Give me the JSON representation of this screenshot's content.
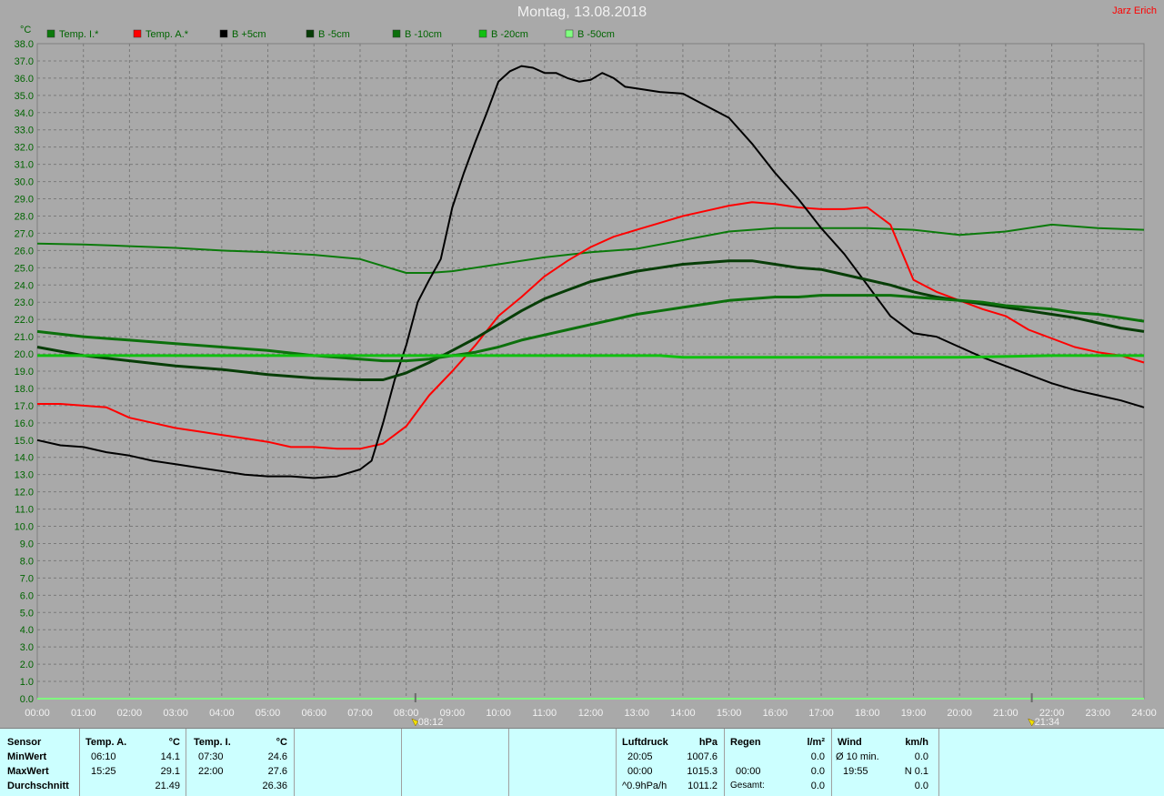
{
  "header": {
    "title": "Montag, 13.08.2018",
    "author": "Jarz Erich"
  },
  "colors": {
    "temp_i": "#0b7a0b",
    "temp_a": "#ff0000",
    "b5": "#000000",
    "bm5": "#073d07",
    "bm10": "#0c700c",
    "bm20": "#10c010",
    "bm50": "#80ff80",
    "axis_text": "#006400",
    "background": "#a9a9a9",
    "panel": "#ccffff"
  },
  "chart_data": {
    "type": "line",
    "ylabel": "°C",
    "ylim": [
      0,
      38
    ],
    "xlim": [
      0,
      24
    ],
    "yticks": [
      "0.0",
      "1.0",
      "2.0",
      "3.0",
      "4.0",
      "5.0",
      "6.0",
      "7.0",
      "8.0",
      "9.0",
      "10.0",
      "11.0",
      "12.0",
      "13.0",
      "14.0",
      "15.0",
      "16.0",
      "17.0",
      "18.0",
      "19.0",
      "20.0",
      "21.0",
      "22.0",
      "23.0",
      "24.0",
      "25.0",
      "26.0",
      "27.0",
      "28.0",
      "29.0",
      "30.0",
      "31.0",
      "32.0",
      "33.0",
      "34.0",
      "35.0",
      "36.0",
      "37.0",
      "38.0"
    ],
    "xticks": [
      "00:00",
      "01:00",
      "02:00",
      "03:00",
      "04:00",
      "05:00",
      "06:00",
      "07:00",
      "08:00",
      "09:00",
      "10:00",
      "11:00",
      "12:00",
      "13:00",
      "14:00",
      "15:00",
      "16:00",
      "17:00",
      "18:00",
      "19:00",
      "20:00",
      "21:00",
      "22:00",
      "23:00",
      "24:00"
    ],
    "grid": true,
    "legend_position": "top-left",
    "sunrise": "08:12",
    "sunset": "21:34",
    "series": [
      {
        "name": "Temp. I.*",
        "color": "#0b7a0b",
        "x": [
          0,
          1,
          2,
          3,
          4,
          5,
          6,
          7,
          7.5,
          8,
          8.5,
          9,
          10,
          11,
          12,
          13,
          14,
          15,
          16,
          17,
          18,
          19,
          20,
          21,
          22,
          23,
          24
        ],
        "y": [
          26.4,
          26.35,
          26.25,
          26.15,
          26.0,
          25.9,
          25.75,
          25.5,
          25.1,
          24.7,
          24.7,
          24.8,
          25.2,
          25.6,
          25.9,
          26.1,
          26.6,
          27.1,
          27.3,
          27.3,
          27.3,
          27.2,
          26.9,
          27.1,
          27.5,
          27.3,
          27.2
        ]
      },
      {
        "name": "Temp. A.*",
        "color": "#ff0000",
        "x": [
          0,
          0.5,
          1,
          1.5,
          2,
          2.5,
          3,
          3.5,
          4,
          4.5,
          5,
          5.5,
          6,
          6.5,
          7,
          7.5,
          8,
          8.5,
          9,
          9.5,
          10,
          10.5,
          11,
          11.5,
          12,
          12.5,
          13,
          13.5,
          14,
          14.5,
          15,
          15.5,
          16,
          16.5,
          17,
          17.5,
          18,
          18.5,
          19,
          19.5,
          20,
          20.5,
          21,
          21.5,
          22,
          22.5,
          23,
          23.5,
          24
        ],
        "y": [
          17.1,
          17.1,
          17.0,
          16.9,
          16.3,
          16.0,
          15.7,
          15.5,
          15.3,
          15.1,
          14.9,
          14.6,
          14.6,
          14.5,
          14.5,
          14.8,
          15.8,
          17.6,
          19.0,
          20.5,
          22.2,
          23.3,
          24.5,
          25.4,
          26.2,
          26.8,
          27.2,
          27.6,
          28.0,
          28.3,
          28.6,
          28.8,
          28.7,
          28.5,
          28.4,
          28.4,
          28.5,
          27.5,
          24.3,
          23.6,
          23.1,
          22.6,
          22.2,
          21.4,
          20.9,
          20.4,
          20.1,
          19.9,
          19.5
        ]
      },
      {
        "name": "B +5cm",
        "color": "#000000",
        "x": [
          0,
          0.5,
          1,
          1.5,
          2,
          2.5,
          3,
          3.5,
          4,
          4.5,
          5,
          5.5,
          6,
          6.5,
          7,
          7.25,
          7.5,
          7.75,
          8,
          8.25,
          8.5,
          8.75,
          9,
          9.25,
          9.5,
          9.75,
          10,
          10.25,
          10.5,
          10.75,
          11,
          11.25,
          11.5,
          11.75,
          12,
          12.25,
          12.5,
          12.75,
          13,
          13.5,
          14,
          14.5,
          15,
          15.5,
          16,
          16.5,
          17,
          17.5,
          18,
          18.5,
          19,
          19.5,
          20,
          20.5,
          21,
          21.5,
          22,
          22.5,
          23,
          23.5,
          24
        ],
        "y": [
          15.0,
          14.7,
          14.6,
          14.3,
          14.1,
          13.8,
          13.6,
          13.4,
          13.2,
          13.0,
          12.9,
          12.9,
          12.8,
          12.9,
          13.3,
          13.8,
          16.0,
          18.5,
          20.5,
          23.0,
          24.3,
          25.5,
          28.5,
          30.5,
          32.3,
          34.0,
          35.8,
          36.4,
          36.7,
          36.6,
          36.3,
          36.3,
          36.0,
          35.8,
          35.9,
          36.3,
          36.0,
          35.5,
          35.4,
          35.2,
          35.1,
          34.4,
          33.7,
          32.2,
          30.5,
          29.0,
          27.3,
          25.8,
          24.0,
          22.2,
          21.2,
          21.0,
          20.4,
          19.8,
          19.3,
          18.8,
          18.3,
          17.9,
          17.6,
          17.3,
          16.9
        ]
      },
      {
        "name": "B -5cm",
        "color": "#073d07",
        "x": [
          0,
          1,
          2,
          3,
          4,
          5,
          6,
          7,
          7.5,
          8,
          8.5,
          9,
          9.5,
          10,
          10.5,
          11,
          11.5,
          12,
          12.5,
          13,
          13.5,
          14,
          14.5,
          15,
          15.5,
          16,
          16.5,
          17,
          17.5,
          18,
          18.5,
          19,
          19.5,
          20,
          20.5,
          21,
          21.5,
          22,
          22.5,
          23,
          23.5,
          24
        ],
        "y": [
          20.4,
          19.9,
          19.6,
          19.3,
          19.1,
          18.8,
          18.6,
          18.5,
          18.5,
          18.9,
          19.5,
          20.2,
          20.9,
          21.7,
          22.5,
          23.2,
          23.7,
          24.2,
          24.5,
          24.8,
          25.0,
          25.2,
          25.3,
          25.4,
          25.4,
          25.2,
          25.0,
          24.9,
          24.6,
          24.3,
          24.0,
          23.6,
          23.3,
          23.1,
          22.9,
          22.7,
          22.5,
          22.3,
          22.1,
          21.8,
          21.5,
          21.3
        ]
      },
      {
        "name": "B -10cm",
        "color": "#0c700c",
        "x": [
          0,
          1,
          2,
          3,
          4,
          5,
          6,
          7,
          7.5,
          8,
          8.5,
          9,
          9.5,
          10,
          10.5,
          11,
          11.5,
          12,
          12.5,
          13,
          13.5,
          14,
          14.5,
          15,
          15.5,
          16,
          16.5,
          17,
          17.5,
          18,
          18.5,
          19,
          19.5,
          20,
          20.5,
          21,
          21.5,
          22,
          22.5,
          23,
          23.5,
          24
        ],
        "y": [
          21.3,
          21.0,
          20.8,
          20.6,
          20.4,
          20.2,
          19.9,
          19.7,
          19.6,
          19.6,
          19.7,
          19.9,
          20.1,
          20.4,
          20.8,
          21.1,
          21.4,
          21.7,
          22.0,
          22.3,
          22.5,
          22.7,
          22.9,
          23.1,
          23.2,
          23.3,
          23.3,
          23.4,
          23.4,
          23.4,
          23.4,
          23.3,
          23.2,
          23.1,
          23.0,
          22.8,
          22.7,
          22.6,
          22.4,
          22.3,
          22.1,
          21.9
        ]
      },
      {
        "name": "B -20cm",
        "color": "#10c010",
        "x": [
          0,
          2,
          4,
          6,
          8,
          10,
          12,
          13.5,
          14,
          16,
          18,
          20,
          22,
          24
        ],
        "y": [
          19.9,
          19.9,
          19.9,
          19.9,
          19.9,
          19.9,
          19.9,
          19.9,
          19.8,
          19.8,
          19.8,
          19.8,
          19.9,
          19.9
        ]
      },
      {
        "name": "B -50cm",
        "color": "#80ff80",
        "x": [
          0,
          24
        ],
        "y": [
          0.0,
          0.0
        ]
      }
    ]
  },
  "stats": {
    "sensor_label": "Sensor",
    "row_labels": [
      "MinWert",
      "MaxWert",
      "Durchschnitt"
    ],
    "temp_a": {
      "header": "Temp. A.",
      "unit": "°C",
      "min_time": "06:10",
      "min_val": "14.1",
      "max_time": "15:25",
      "max_val": "29.1",
      "avg": "21.49"
    },
    "temp_i": {
      "header": "Temp. I.",
      "unit": "°C",
      "min_time": "07:30",
      "min_val": "24.6",
      "max_time": "22:00",
      "max_val": "27.6",
      "avg": "26.36"
    },
    "pressure": {
      "header": "Luftdruck",
      "unit": "hPa",
      "min_time": "20:05",
      "min_val": "1007.6",
      "max_time": "00:00",
      "max_val": "1015.3",
      "trend": "^0.9hPa/h",
      "avg": "1011.2"
    },
    "rain": {
      "header": "Regen",
      "unit": "l/m²",
      "time": "00:00",
      "max_val": "0.0",
      "min_val": "0.0",
      "total_label": "Gesamt:",
      "total": "0.0"
    },
    "wind": {
      "header": "Wind",
      "unit": "km/h",
      "avg_label": "Ø 10 min.",
      "avg_val": "0.0",
      "max_time": "19:55",
      "max_val": "N 0.1",
      "total": "0.0"
    }
  }
}
